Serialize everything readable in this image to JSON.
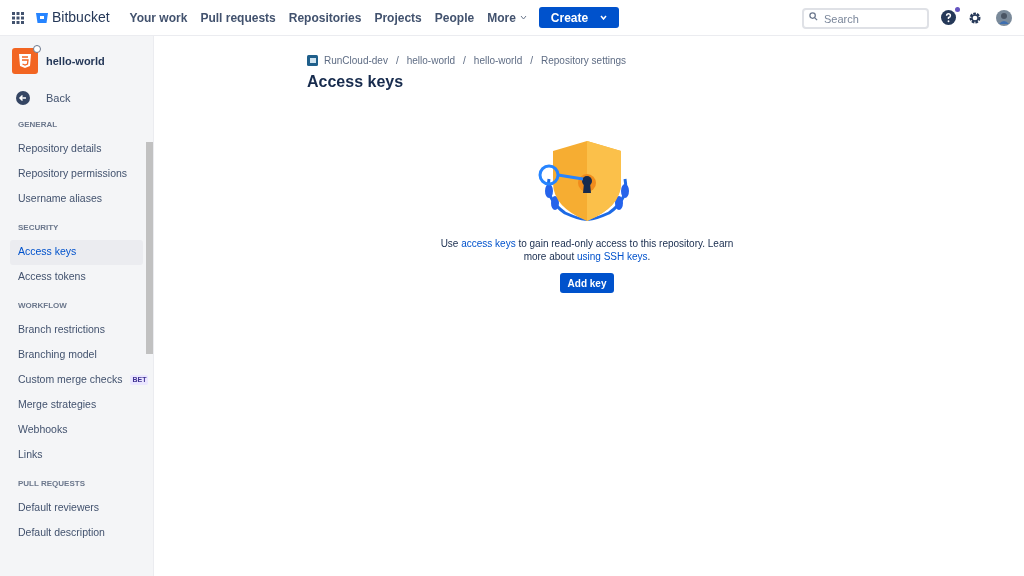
{
  "topbar": {
    "product": "Bitbucket",
    "nav": [
      "Your work",
      "Pull requests",
      "Repositories",
      "Projects",
      "People"
    ],
    "more": "More",
    "create": "Create",
    "search": {
      "placeholder": "Search"
    },
    "help_notification": true
  },
  "sidebar": {
    "repo": "hello-world",
    "back": "Back",
    "sections": [
      {
        "title": "GENERAL",
        "items": [
          {
            "label": "Repository details",
            "selected": false
          },
          {
            "label": "Repository permissions",
            "selected": false
          },
          {
            "label": "Username aliases",
            "selected": false
          }
        ]
      },
      {
        "title": "SECURITY",
        "items": [
          {
            "label": "Access keys",
            "selected": true
          },
          {
            "label": "Access tokens",
            "selected": false
          }
        ]
      },
      {
        "title": "WORKFLOW",
        "items": [
          {
            "label": "Branch restrictions",
            "selected": false
          },
          {
            "label": "Branching model",
            "selected": false
          },
          {
            "label": "Custom merge checks",
            "selected": false,
            "badge": "BET"
          },
          {
            "label": "Merge strategies",
            "selected": false
          },
          {
            "label": "Webhooks",
            "selected": false
          },
          {
            "label": "Links",
            "selected": false
          }
        ]
      },
      {
        "title": "PULL REQUESTS",
        "items": [
          {
            "label": "Default reviewers",
            "selected": false
          },
          {
            "label": "Default description",
            "selected": false
          }
        ]
      }
    ]
  },
  "breadcrumbs": [
    {
      "label": "RunCloud-dev"
    },
    {
      "separator": "/",
      "label": "hello-world"
    },
    {
      "separator": "/",
      "label": "hello-world"
    },
    {
      "separator": "/",
      "label": "Repository settings"
    }
  ],
  "title": "Access keys",
  "description": [
    {
      "kind": "text",
      "text": "Use "
    },
    {
      "kind": "link",
      "text": "access keys"
    },
    {
      "kind": "text",
      "text": " to gain read-only access to this repository. Learn more about "
    },
    {
      "kind": "link",
      "text": "using SSH keys"
    },
    {
      "kind": "text",
      "text": "."
    }
  ],
  "button": "Add key"
}
